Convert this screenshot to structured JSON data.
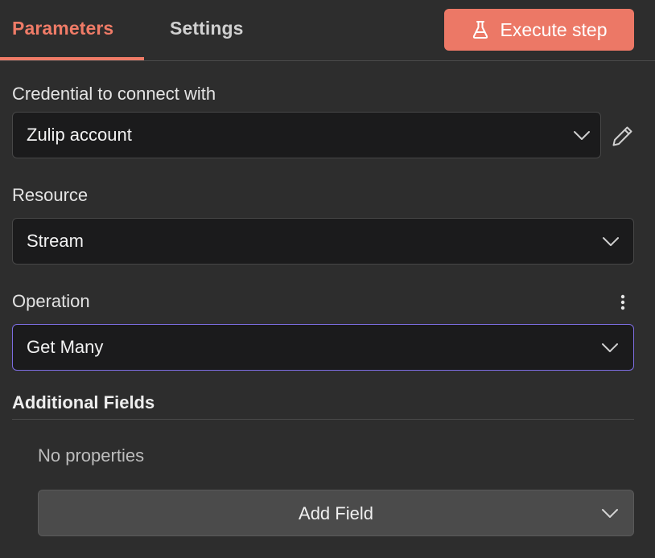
{
  "tabs": {
    "parameters": "Parameters",
    "settings": "Settings"
  },
  "execute_button": {
    "label": "Execute step",
    "icon": "flask-icon",
    "color": "#ec7866"
  },
  "credential": {
    "label": "Credential to connect with",
    "value": "Zulip account",
    "edit_icon": "pencil-icon"
  },
  "resource": {
    "label": "Resource",
    "value": "Stream"
  },
  "operation": {
    "label": "Operation",
    "value": "Get Many",
    "menu_icon": "kebab-icon"
  },
  "additional_fields": {
    "title": "Additional Fields",
    "empty_text": "No properties",
    "add_button": "Add Field"
  },
  "colors": {
    "accent": "#ef7b67",
    "focus_border": "#7c6de0",
    "background": "#2d2d2d"
  }
}
